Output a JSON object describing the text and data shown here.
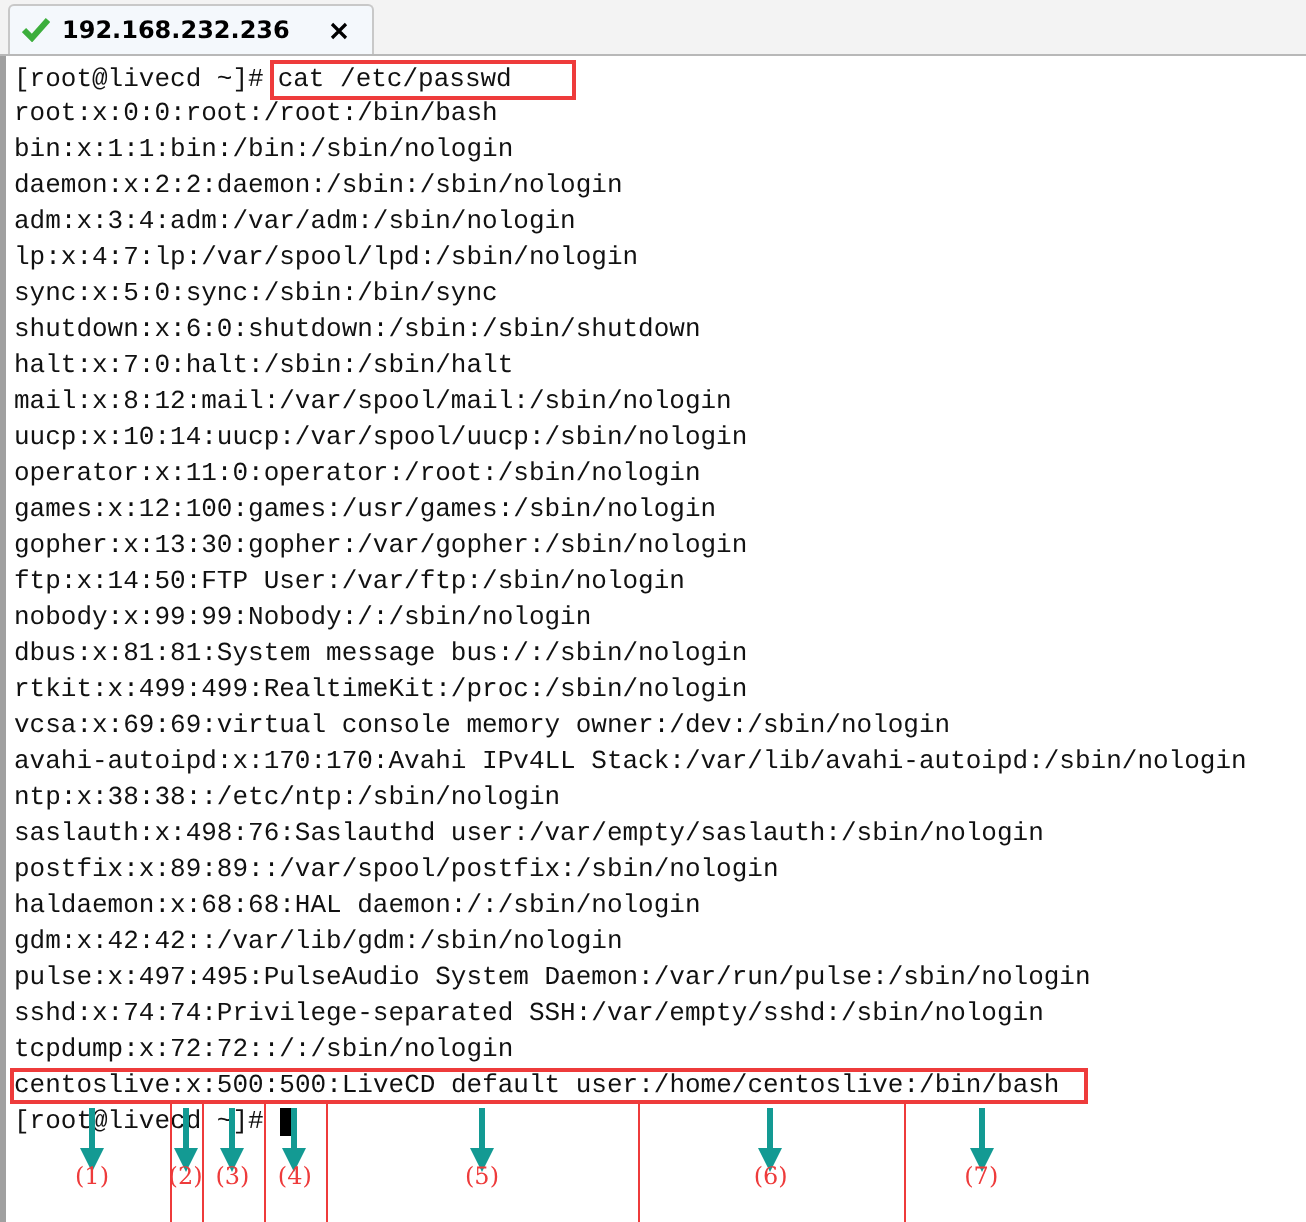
{
  "tab": {
    "title": "192.168.232.236",
    "connected": true
  },
  "terminal": {
    "prompt": "[root@livecd ~]#",
    "command": "cat /etc/passwd",
    "lines": [
      "root:x:0:0:root:/root:/bin/bash",
      "bin:x:1:1:bin:/bin:/sbin/nologin",
      "daemon:x:2:2:daemon:/sbin:/sbin/nologin",
      "adm:x:3:4:adm:/var/adm:/sbin/nologin",
      "lp:x:4:7:lp:/var/spool/lpd:/sbin/nologin",
      "sync:x:5:0:sync:/sbin:/bin/sync",
      "shutdown:x:6:0:shutdown:/sbin:/sbin/shutdown",
      "halt:x:7:0:halt:/sbin:/sbin/halt",
      "mail:x:8:12:mail:/var/spool/mail:/sbin/nologin",
      "uucp:x:10:14:uucp:/var/spool/uucp:/sbin/nologin",
      "operator:x:11:0:operator:/root:/sbin/nologin",
      "games:x:12:100:games:/usr/games:/sbin/nologin",
      "gopher:x:13:30:gopher:/var/gopher:/sbin/nologin",
      "ftp:x:14:50:FTP User:/var/ftp:/sbin/nologin",
      "nobody:x:99:99:Nobody:/:/sbin/nologin",
      "dbus:x:81:81:System message bus:/:/sbin/nologin",
      "rtkit:x:499:499:RealtimeKit:/proc:/sbin/nologin",
      "vcsa:x:69:69:virtual console memory owner:/dev:/sbin/nologin",
      "avahi-autoipd:x:170:170:Avahi IPv4LL Stack:/var/lib/avahi-autoipd:/sbin/nologin",
      "ntp:x:38:38::/etc/ntp:/sbin/nologin",
      "saslauth:x:498:76:Saslauthd user:/var/empty/saslauth:/sbin/nologin",
      "postfix:x:89:89::/var/spool/postfix:/sbin/nologin",
      "haldaemon:x:68:68:HAL daemon:/:/sbin/nologin",
      "gdm:x:42:42::/var/lib/gdm:/sbin/nologin",
      "pulse:x:497:495:PulseAudio System Daemon:/var/run/pulse:/sbin/nologin",
      "sshd:x:74:74:Privilege-separated SSH:/var/empty/sshd:/sbin/nologin",
      "tcpdump:x:72:72::/:/sbin/nologin"
    ],
    "annotated_entry": [
      {
        "text": "centoslive",
        "label": "(1)"
      },
      {
        "text": ":x",
        "label": "(2)"
      },
      {
        "text": ":500",
        "label": "(3)"
      },
      {
        "text": ":500",
        "label": "(4)"
      },
      {
        "text": ":LiveCD default user",
        "label": "(5)"
      },
      {
        "text": ":/home/centoslive",
        "label": "(6)"
      },
      {
        "text": ":/bin/bash",
        "label": "(7)"
      }
    ],
    "final_prompt": "[root@livecd ~]#"
  }
}
